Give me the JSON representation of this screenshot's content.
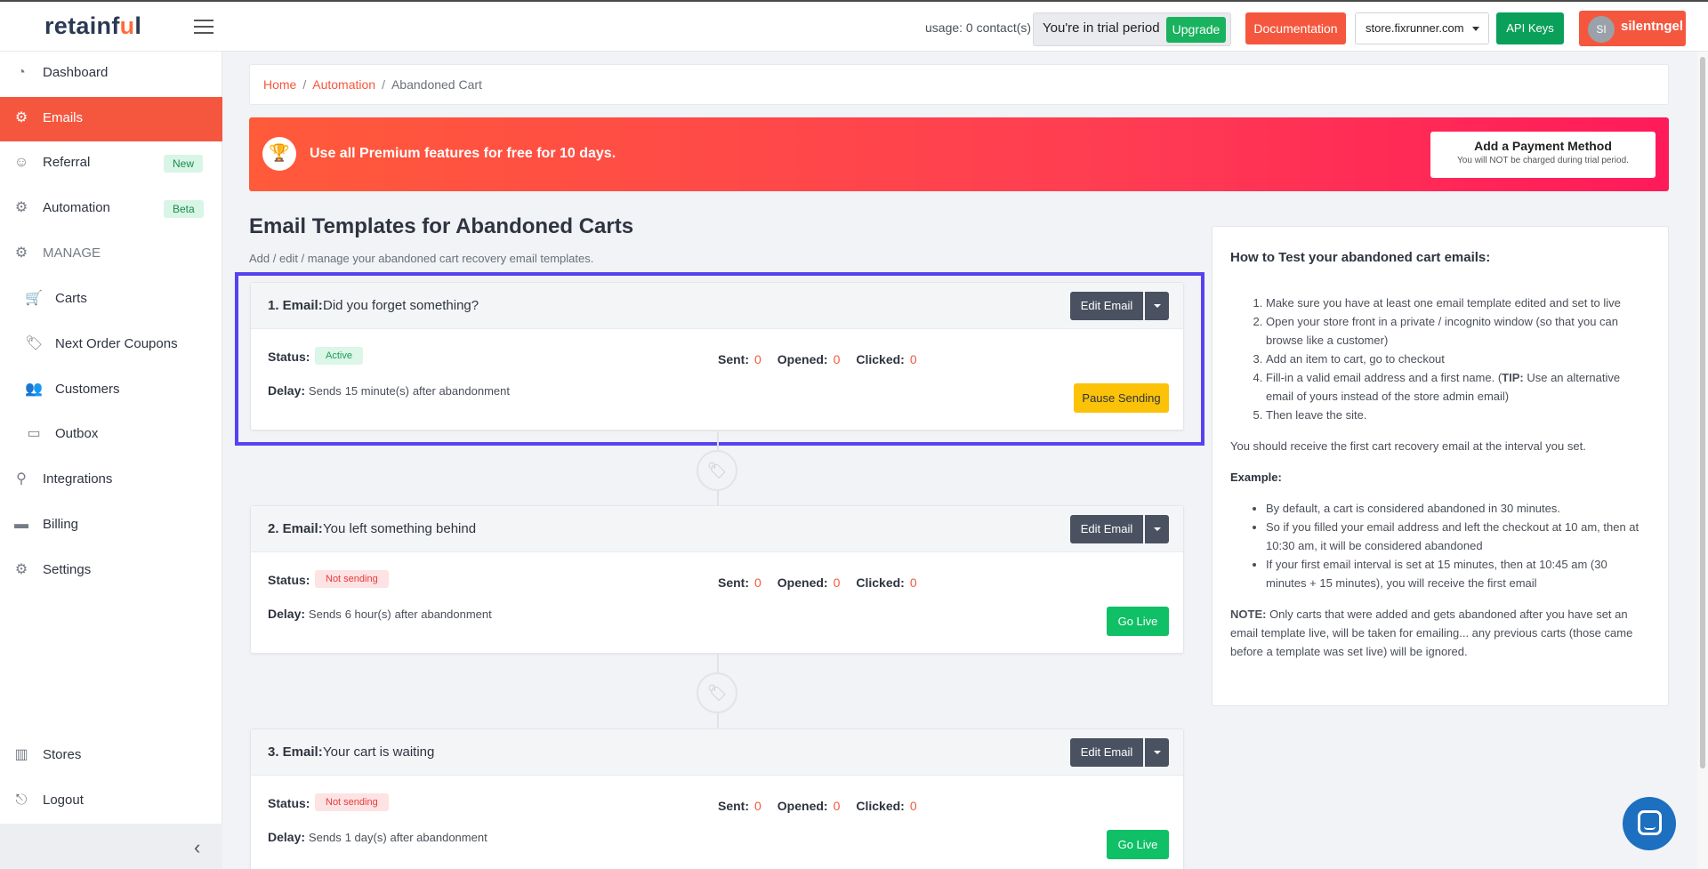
{
  "header": {
    "logo_pre": "retainf",
    "logo_u": "u",
    "logo_post": "l",
    "usage": "usage: 0 contact(s)",
    "trial_text": "You're in trial period",
    "upgrade_label": "Upgrade",
    "documentation_label": "Documentation",
    "store_selected": "store.fixrunner.com",
    "api_keys_label": "API Keys",
    "user_initials": "SI",
    "username": "silentngel"
  },
  "sidebar": {
    "items": [
      {
        "label": "Dashboard"
      },
      {
        "label": "Emails"
      },
      {
        "label": "Referral",
        "badge": "New"
      },
      {
        "label": "Automation",
        "badge": "Beta"
      },
      {
        "label": "MANAGE"
      },
      {
        "label": "Carts"
      },
      {
        "label": "Next Order Coupons"
      },
      {
        "label": "Customers"
      },
      {
        "label": "Outbox"
      },
      {
        "label": "Integrations"
      },
      {
        "label": "Billing"
      },
      {
        "label": "Settings"
      },
      {
        "label": "Stores"
      },
      {
        "label": "Logout"
      }
    ]
  },
  "breadcrumb": {
    "home": "Home",
    "automation": "Automation",
    "current": "Abandoned Cart"
  },
  "promo": {
    "message": "Use all Premium features for free for 10 days.",
    "button_title": "Add a Payment Method",
    "button_sub": "You will NOT be charged during trial period."
  },
  "page": {
    "title": "Email Templates for Abandoned Carts",
    "subtitle": "Add / edit / manage your abandoned cart recovery email templates."
  },
  "labels": {
    "edit": "Edit Email",
    "status": "Status:",
    "delay": "Delay:",
    "sends": "Sends",
    "after": "after abandonment",
    "sent": "Sent:",
    "opened": "Opened:",
    "clicked": "Clicked:"
  },
  "emails": [
    {
      "number": "1. Email:",
      "subject": "Did you forget something?",
      "status": "Active",
      "delay": "15 minute(s)",
      "sent": "0",
      "opened": "0",
      "clicked": "0",
      "action": "Pause Sending"
    },
    {
      "number": "2. Email:",
      "subject": "You left something behind",
      "status": "Not sending",
      "delay": "6 hour(s)",
      "sent": "0",
      "opened": "0",
      "clicked": "0",
      "action": "Go Live"
    },
    {
      "number": "3. Email:",
      "subject": "Your cart is waiting",
      "status": "Not sending",
      "delay": "1 day(s)",
      "sent": "0",
      "opened": "0",
      "clicked": "0",
      "action": "Go Live"
    }
  ],
  "help": {
    "title": "How to Test your abandoned cart emails:",
    "steps": [
      "Make sure you have at least one email template edited and set to live",
      "Open your store front in a private / incognito window (so that you can browse like a customer)",
      "Add an item to cart, go to checkout",
      "Fill-in a valid email address and a first name. (",
      "TIP:",
      " Use an alternative email of yours instead of the store admin email)",
      "Then leave the site."
    ],
    "receive": "You should receive the first cart recovery email at the interval you set.",
    "example_label": "Example:",
    "examples": [
      "By default, a cart is considered abandoned in 30 minutes.",
      "So if you filled your email address and left the checkout at 10 am, then at 10:30 am, it will be considered abandoned",
      "If your first email interval is set at 15 minutes, then at 10:45 am (30 minutes + 15 minutes), you will receive the first email"
    ],
    "note_label": "NOTE:",
    "note": " Only carts that were added and gets abandoned after you have set an email template live, will be taken for emailing... any previous carts (those came before a template was set live) will be ignored."
  }
}
